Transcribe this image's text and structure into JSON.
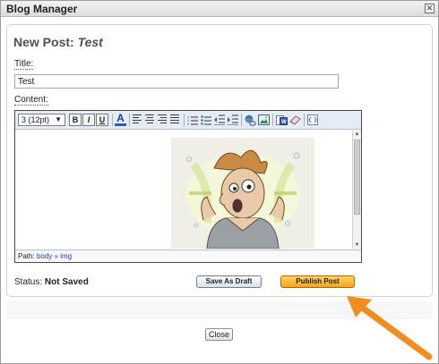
{
  "window": {
    "title": "Blog Manager",
    "close_glyph": "✕"
  },
  "heading": {
    "prefix": "New Post: ",
    "post_name": "Test"
  },
  "form": {
    "title_label": "Title:",
    "title_value": "Test",
    "content_label": "Content:"
  },
  "toolbar": {
    "font_size": "3 (12pt)",
    "bold": "B",
    "italic": "I",
    "underline": "U",
    "icons": [
      "font-color-icon",
      "align-left-icon",
      "align-center-icon",
      "align-right-icon",
      "align-justify-icon",
      "ordered-list-icon",
      "unordered-list-icon",
      "outdent-icon",
      "indent-icon",
      "link-icon",
      "image-icon",
      "paste-word-icon",
      "eraser-icon",
      "html-source-icon"
    ]
  },
  "pathbar": {
    "prefix": "Path:",
    "items": [
      "body",
      "img"
    ],
    "separator": "»"
  },
  "status": {
    "label": "Status:",
    "value": "Not Saved"
  },
  "buttons": {
    "save_draft": "Save As Draft",
    "publish": "Publish Post",
    "close": "Close"
  },
  "colors": {
    "publish_button": "#f7b531",
    "annotation_arrow": "#f28c1e",
    "path_link": "#1f3fbf"
  }
}
